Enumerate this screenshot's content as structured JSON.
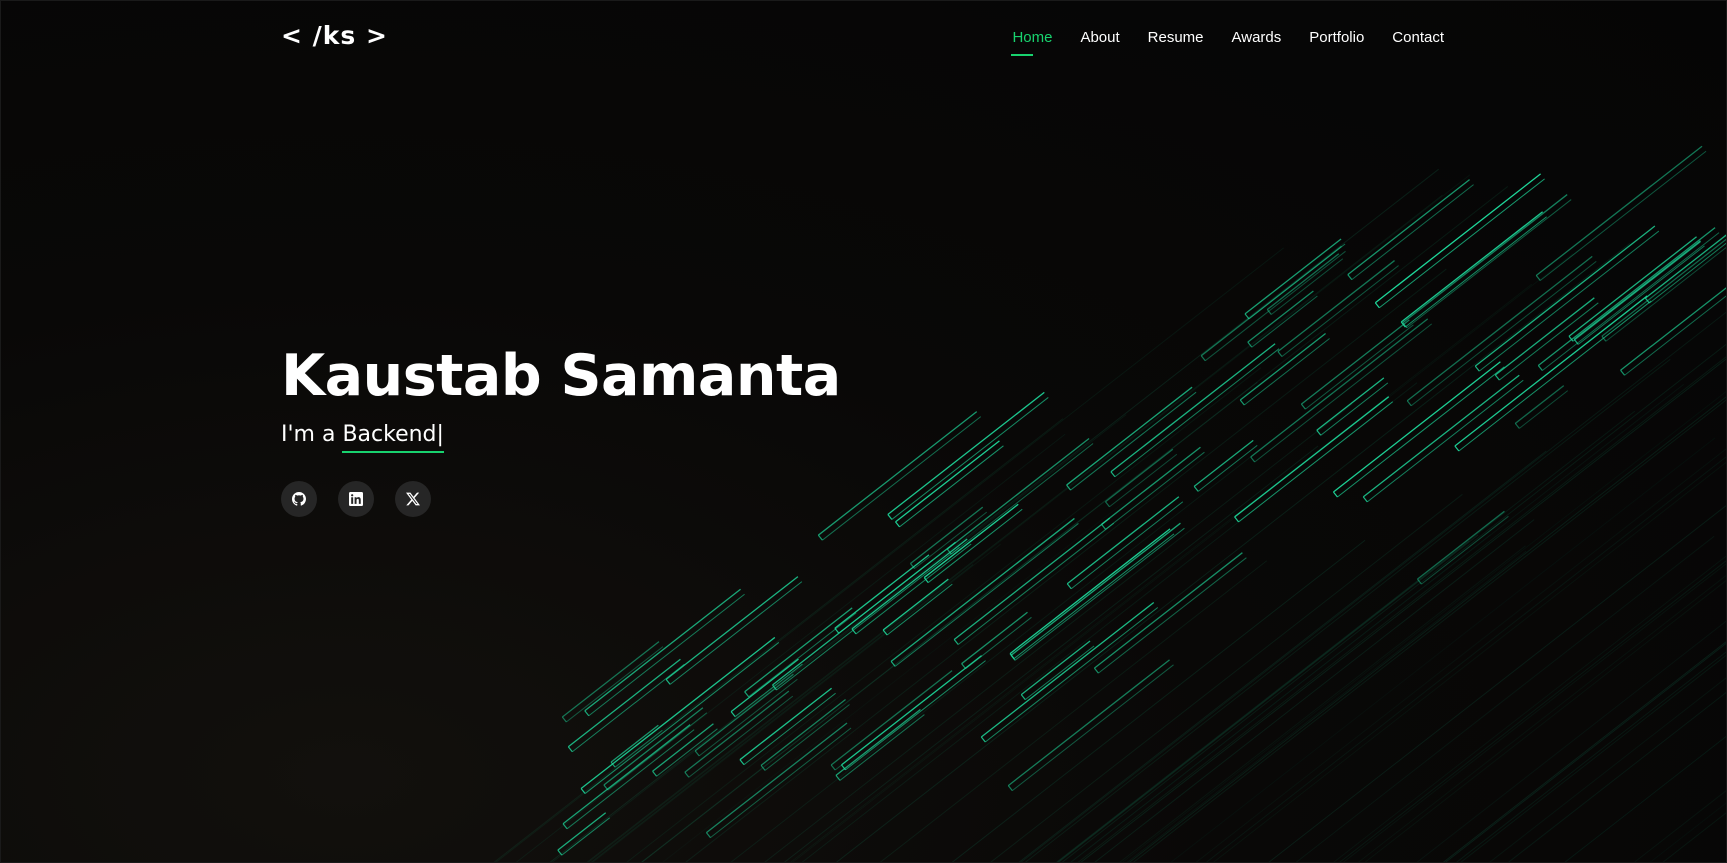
{
  "brand": {
    "logo_text": "< /ks >"
  },
  "nav": {
    "items": [
      {
        "label": "Home",
        "active": true
      },
      {
        "label": "About"
      },
      {
        "label": "Resume"
      },
      {
        "label": "Awards"
      },
      {
        "label": "Portfolio"
      },
      {
        "label": "Contact"
      }
    ]
  },
  "hero": {
    "name": "Kaustab Samanta",
    "prefix": "I'm a ",
    "typed": "Backend",
    "cursor": "|"
  },
  "socials": [
    {
      "icon": "github-icon"
    },
    {
      "icon": "linkedin-icon"
    },
    {
      "icon": "x-icon"
    }
  ],
  "colors": {
    "accent": "#18d26e",
    "background": "#070606",
    "lines": "#1ed79a",
    "social_bg": "#262626"
  }
}
